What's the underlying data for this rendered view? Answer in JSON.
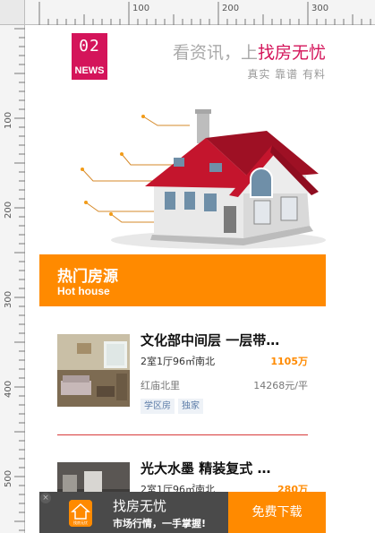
{
  "ruler": {
    "top_numbers": [
      "100",
      "200",
      "300"
    ],
    "left_numbers": [
      "100",
      "200",
      "300",
      "400",
      "500"
    ]
  },
  "banner": {
    "logo_number": "02",
    "logo_label": "NEWS",
    "slogan_prefix": "看资讯，上",
    "slogan_brand": "找房无忧",
    "sub_slogan": "真实 靠谱 有料"
  },
  "section": {
    "title": "热门房源",
    "subtitle": "Hot house"
  },
  "listings": [
    {
      "title": "文化部中间层 一层带…",
      "spec": "2室1厅96㎡南北",
      "price": "1105万",
      "area": "红庙北里",
      "unit_price": "14268元/平",
      "tags": [
        "学区房",
        "独家"
      ]
    },
    {
      "title": "光大水墨 精装复式 …",
      "spec": "2室1厅96㎡南北",
      "price": "280万"
    }
  ],
  "download_bar": {
    "close": "×",
    "app_name": "找房无忧",
    "app_desc": "市场行情，一手掌握!",
    "icon_text": "找房无忧",
    "button": "免费下载"
  },
  "colors": {
    "accent_orange": "#ff8a00",
    "brand_red": "#d4145a",
    "tag_text": "#5c7ca8"
  }
}
